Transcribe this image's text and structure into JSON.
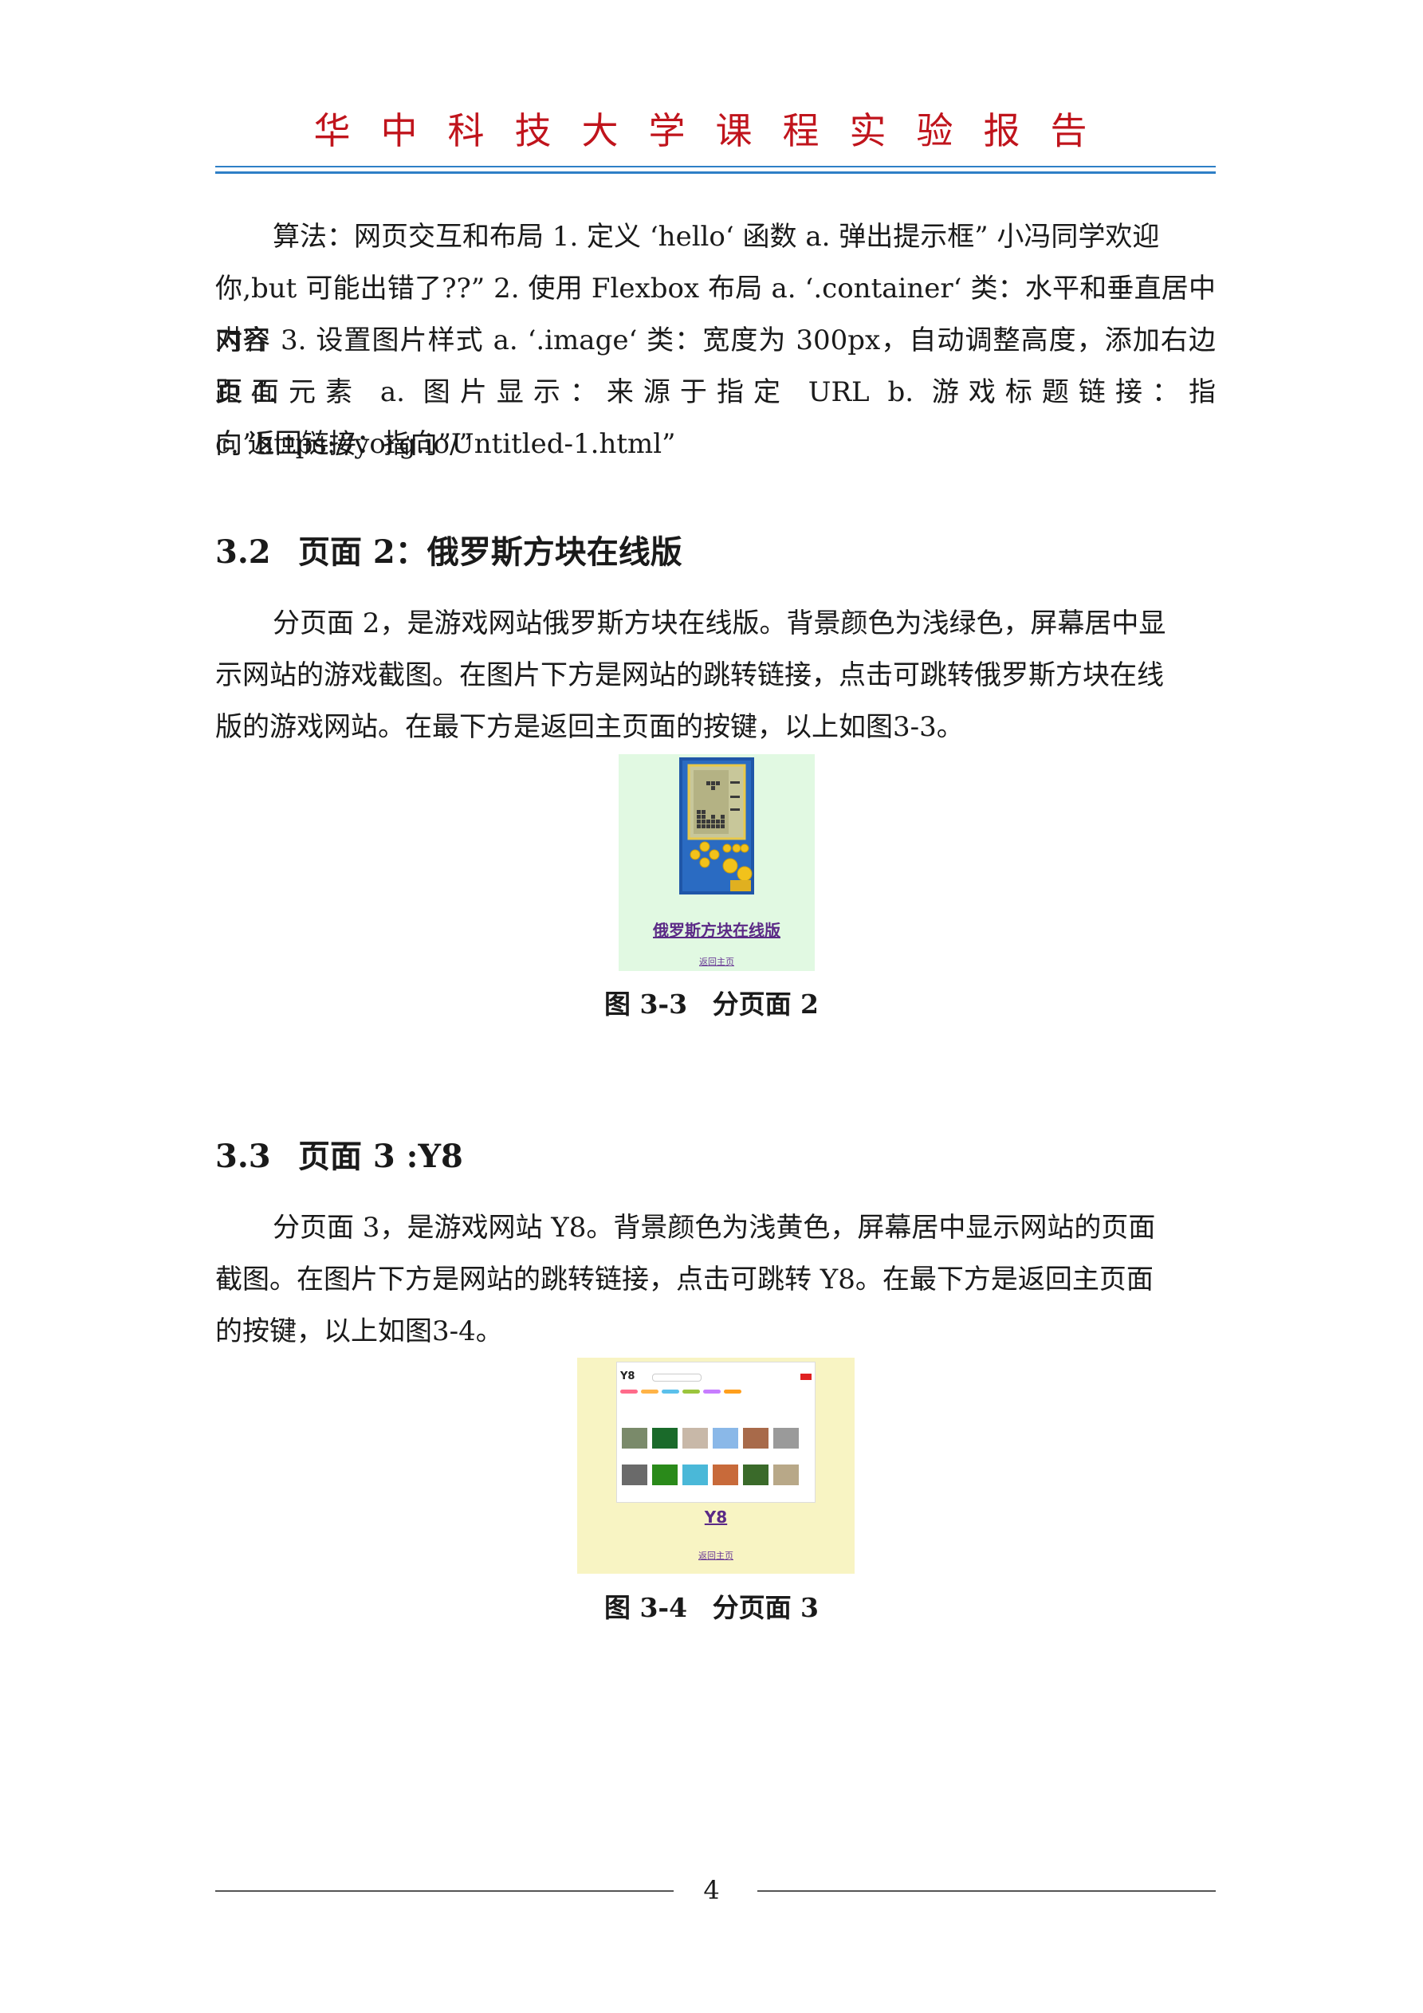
{
  "header": {
    "title": "华中科技大学课程实验报告"
  },
  "colors": {
    "header_red": "#c0141c",
    "rule_blue": "#2e7fc6",
    "tetris_bg": "#e1f9e2",
    "y8_bg": "#f8f4c3"
  },
  "intro": {
    "lines": [
      "算法：网页交互和布局 1. 定义 ‘hello‘ 函数 a. 弹出提示框” 小冯同学欢迎",
      "你,but 可能出错了??” 2. 使用 Flexbox 布局 a. ‘.container‘ 类：水平和垂直居中对齐",
      "内容 3. 设置图片样式 a. ‘.image‘ 类：宽度为 300px，自动调整高度，添加右边距 4.",
      "页面元素 a. 图片显示：来源于指定 URL b. 游戏标题链接：指向”https://yorg.io/”",
      "c. 返回链接：指向”Untitled-1.html”"
    ]
  },
  "section32": {
    "number": "3.2",
    "title": "页面 2：俄罗斯方块在线版",
    "lines": [
      "分页面 2，是游戏网站俄罗斯方块在线版。背景颜色为浅绿色，屏幕居中显",
      "示网站的游戏截图。在图片下方是网站的跳转链接，点击可跳转俄罗斯方块在线",
      "版的游戏网站。在最下方是返回主页面的按键，以上如图3-3。"
    ],
    "figure": {
      "game_link": "俄罗斯方块在线版",
      "back_link": "返回主页",
      "caption_label": "图 3-3",
      "caption_text": "分页面 2"
    }
  },
  "section33": {
    "number": "3.3",
    "title": "页面 3 :Y8",
    "lines": [
      "分页面 3，是游戏网站 Y8。背景颜色为浅黄色，屏幕居中显示网站的页面",
      "截图。在图片下方是网站的跳转链接，点击可跳转 Y8。在最下方是返回主页面",
      "的按键，以上如图3-4。"
    ],
    "figure": {
      "logo": "Y8",
      "game_link": "Y8",
      "back_link": "返回主页",
      "caption_label": "图 3-4",
      "caption_text": "分页面 3"
    }
  },
  "footer": {
    "page_number": "4"
  }
}
